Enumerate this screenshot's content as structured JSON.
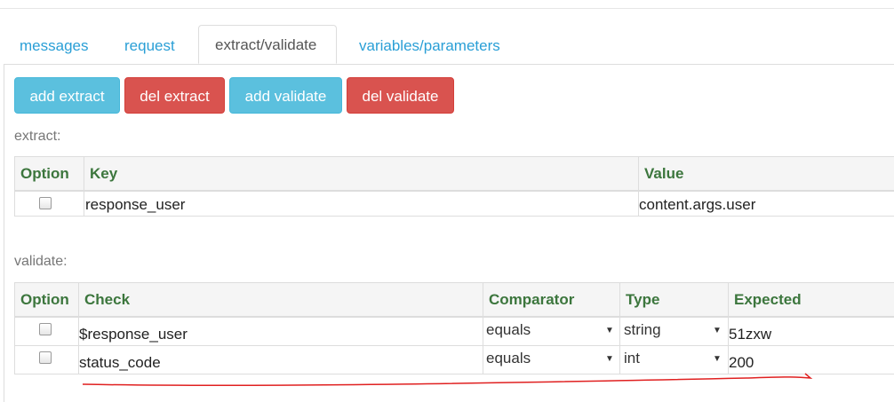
{
  "tabs": [
    {
      "label": "messages",
      "active": false
    },
    {
      "label": "request",
      "active": false
    },
    {
      "label": "extract/validate",
      "active": true
    },
    {
      "label": "variables/parameters",
      "active": false
    }
  ],
  "toolbar": {
    "add_extract": "add extract",
    "del_extract": "del extract",
    "add_validate": "add validate",
    "del_validate": "del validate"
  },
  "colors": {
    "info": "#5bc0de",
    "danger": "#d9534f",
    "header_text": "#3c763d",
    "link": "#2a9fd6"
  },
  "extract": {
    "label": "extract:",
    "columns": [
      "Option",
      "Key",
      "Value"
    ],
    "rows": [
      {
        "checked": false,
        "key": "response_user",
        "value": "content.args.user"
      }
    ]
  },
  "validate": {
    "label": "validate:",
    "columns": [
      "Option",
      "Check",
      "Comparator",
      "Type",
      "Expected"
    ],
    "rows": [
      {
        "checked": false,
        "check": "$response_user",
        "comparator": "equals",
        "type": "string",
        "expected": "51zxw"
      },
      {
        "checked": false,
        "check": "status_code",
        "comparator": "equals",
        "type": "int",
        "expected": "200"
      }
    ]
  }
}
